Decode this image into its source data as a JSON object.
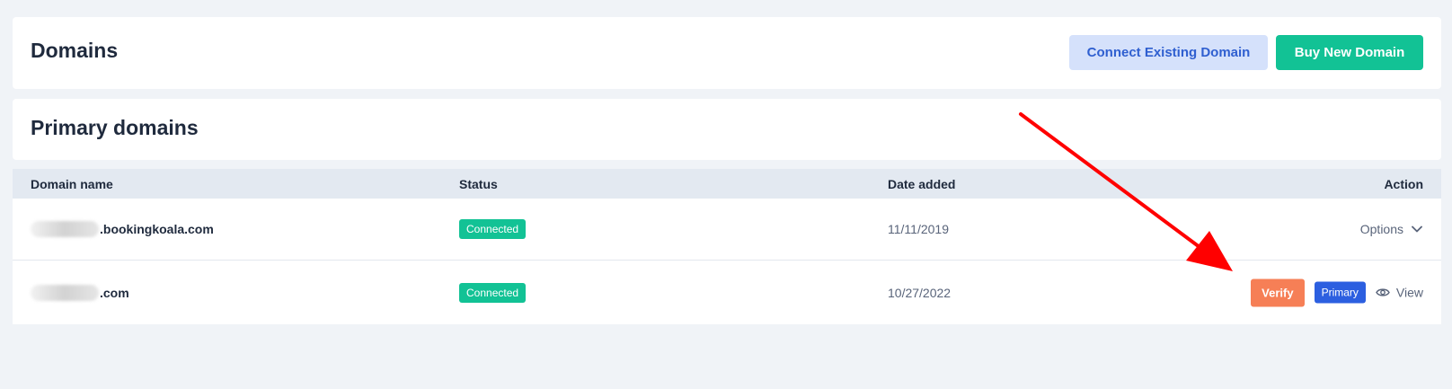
{
  "header": {
    "title": "Domains",
    "connect_label": "Connect Existing Domain",
    "buy_label": "Buy New Domain"
  },
  "section": {
    "title": "Primary domains"
  },
  "table": {
    "columns": [
      "Domain name",
      "Status",
      "Date added",
      "Action"
    ],
    "rows": [
      {
        "domain_suffix": ".bookingkoala.com",
        "status": "Connected",
        "date_added": "11/11/2019",
        "action_label": "Options"
      },
      {
        "domain_suffix": ".com",
        "status": "Connected",
        "date_added": "10/27/2022",
        "verify_label": "Verify",
        "primary_label": "Primary",
        "view_label": "View"
      }
    ]
  },
  "colors": {
    "accent_green": "#12c295",
    "accent_blue": "#2c5fe0",
    "verify_orange": "#f67f56",
    "annotation_arrow": "#ff0000"
  },
  "icons": [
    "chevron-down-icon",
    "eye-icon",
    "annotation-arrow"
  ]
}
